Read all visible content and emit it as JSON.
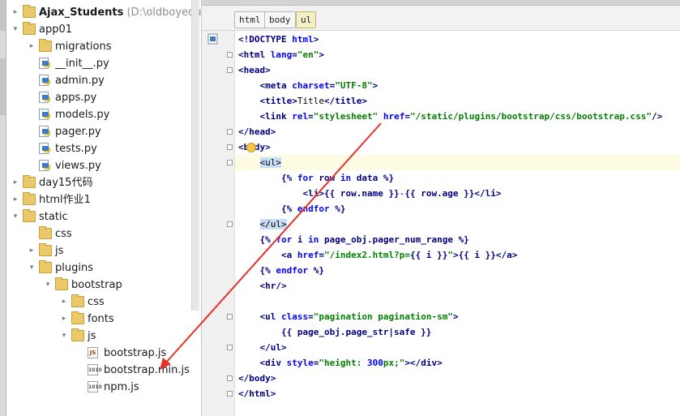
{
  "project": {
    "name": "Ajax_Students",
    "path": "(D:\\oldboyedu\\djang"
  },
  "tree": [
    {
      "label": "Ajax_Students",
      "depth": 0,
      "type": "folder",
      "expanded": false
    },
    {
      "label": "app01",
      "depth": 0,
      "type": "folder",
      "expanded": true
    },
    {
      "label": "migrations",
      "depth": 1,
      "type": "folder",
      "expanded": false
    },
    {
      "label": "__init__.py",
      "depth": 1,
      "type": "py"
    },
    {
      "label": "admin.py",
      "depth": 1,
      "type": "py"
    },
    {
      "label": "apps.py",
      "depth": 1,
      "type": "py"
    },
    {
      "label": "models.py",
      "depth": 1,
      "type": "py"
    },
    {
      "label": "pager.py",
      "depth": 1,
      "type": "py"
    },
    {
      "label": "tests.py",
      "depth": 1,
      "type": "py"
    },
    {
      "label": "views.py",
      "depth": 1,
      "type": "py"
    },
    {
      "label": "day15代码",
      "depth": 0,
      "type": "folder",
      "expanded": false
    },
    {
      "label": "html作业1",
      "depth": 0,
      "type": "folder",
      "expanded": false
    },
    {
      "label": "static",
      "depth": 0,
      "type": "folder",
      "expanded": true
    },
    {
      "label": "css",
      "depth": 1,
      "type": "folder",
      "leaf": true
    },
    {
      "label": "js",
      "depth": 1,
      "type": "folder",
      "expanded": false
    },
    {
      "label": "plugins",
      "depth": 1,
      "type": "folder",
      "expanded": true
    },
    {
      "label": "bootstrap",
      "depth": 2,
      "type": "folder",
      "expanded": true
    },
    {
      "label": "css",
      "depth": 3,
      "type": "folder",
      "expanded": false
    },
    {
      "label": "fonts",
      "depth": 3,
      "type": "folder",
      "expanded": false
    },
    {
      "label": "js",
      "depth": 3,
      "type": "folder",
      "expanded": true
    },
    {
      "label": "bootstrap.js",
      "depth": 4,
      "type": "js"
    },
    {
      "label": "bootstrap.min.js",
      "depth": 4,
      "type": "jsbin"
    },
    {
      "label": "npm.js",
      "depth": 4,
      "type": "jsbin"
    }
  ],
  "breadcrumbs": [
    "html",
    "body",
    "ul"
  ],
  "code_lines": [
    [
      [
        "tag",
        "<!DOCTYPE "
      ],
      [
        "attr",
        "html"
      ],
      [
        "tag",
        ">"
      ]
    ],
    [
      [
        "tag",
        "<html "
      ],
      [
        "attr",
        "lang"
      ],
      [
        "tag",
        "="
      ],
      [
        "str",
        "\"en\""
      ],
      [
        "tag",
        ">"
      ]
    ],
    [
      [
        "tag",
        "<head>"
      ]
    ],
    [
      [
        "",
        "    "
      ],
      [
        "tag",
        "<meta "
      ],
      [
        "attr",
        "charset"
      ],
      [
        "tag",
        "="
      ],
      [
        "str",
        "\"UTF-8\""
      ],
      [
        "tag",
        ">"
      ]
    ],
    [
      [
        "",
        "    "
      ],
      [
        "tag",
        "<title>"
      ],
      [
        "",
        "Title"
      ],
      [
        "tag",
        "</title>"
      ]
    ],
    [
      [
        "",
        "    "
      ],
      [
        "tag",
        "<link "
      ],
      [
        "attr",
        "rel"
      ],
      [
        "tag",
        "="
      ],
      [
        "str",
        "\"stylesheet\""
      ],
      [
        "tag",
        " "
      ],
      [
        "attr",
        "href"
      ],
      [
        "tag",
        "="
      ],
      [
        "str",
        "\"/static/plugins/bootstrap/css/bootstrap.css\""
      ],
      [
        "tag",
        "/>"
      ]
    ],
    [
      [
        "tag",
        "</head>"
      ]
    ],
    [
      [
        "tag",
        "<body>"
      ]
    ],
    [
      [
        "",
        "    "
      ],
      [
        "tagbox",
        "<ul>"
      ]
    ],
    [
      [
        "",
        "        "
      ],
      [
        "tpl",
        "{% "
      ],
      [
        "attr",
        "for "
      ],
      [
        "tpl",
        "row "
      ],
      [
        "attr",
        "in "
      ],
      [
        "tpl",
        "data %}"
      ]
    ],
    [
      [
        "",
        "            "
      ],
      [
        "tag",
        "<li>"
      ],
      [
        "tpl",
        "{{ row.name }}"
      ],
      [
        "",
        "-"
      ],
      [
        "tpl",
        "{{ row.age }}"
      ],
      [
        "tag",
        "</li>"
      ]
    ],
    [
      [
        "",
        "        "
      ],
      [
        "tpl",
        "{% "
      ],
      [
        "attr",
        "endfor"
      ],
      [
        "tpl",
        " %}"
      ]
    ],
    [
      [
        "",
        "    "
      ],
      [
        "tagbox",
        "</ul>"
      ]
    ],
    [
      [
        "",
        "    "
      ],
      [
        "tpl",
        "{% "
      ],
      [
        "attr",
        "for "
      ],
      [
        "tpl",
        "i "
      ],
      [
        "attr",
        "in "
      ],
      [
        "tpl",
        "page_obj.pager_num_range %}"
      ]
    ],
    [
      [
        "",
        "        "
      ],
      [
        "tag",
        "<a "
      ],
      [
        "attr",
        "href"
      ],
      [
        "tag",
        "="
      ],
      [
        "str",
        "\"/index2.html?p="
      ],
      [
        "tpl",
        "{{ i }}"
      ],
      [
        "str",
        "\""
      ],
      [
        "tag",
        ">"
      ],
      [
        "tpl",
        "{{ i }}"
      ],
      [
        "tag",
        "</a>"
      ]
    ],
    [
      [
        "",
        "    "
      ],
      [
        "tpl",
        "{% "
      ],
      [
        "attr",
        "endfor"
      ],
      [
        "tpl",
        " %}"
      ]
    ],
    [
      [
        "",
        "    "
      ],
      [
        "tag",
        "<hr/>"
      ]
    ],
    [
      [
        "",
        ""
      ]
    ],
    [
      [
        "",
        "    "
      ],
      [
        "tag",
        "<ul "
      ],
      [
        "attr",
        "class"
      ],
      [
        "tag",
        "="
      ],
      [
        "str",
        "\"pagination pagination-sm\""
      ],
      [
        "tag",
        ">"
      ]
    ],
    [
      [
        "",
        "        "
      ],
      [
        "tpl",
        "{{ page_obj.page_str|safe }}"
      ]
    ],
    [
      [
        "",
        "    "
      ],
      [
        "tag",
        "</ul>"
      ]
    ],
    [
      [
        "",
        "    "
      ],
      [
        "tag",
        "<div "
      ],
      [
        "attr",
        "style"
      ],
      [
        "tag",
        "="
      ],
      [
        "str",
        "\"height: "
      ],
      [
        "attr",
        "300"
      ],
      [
        "str",
        "px;\""
      ],
      [
        "tag",
        ">"
      ],
      [
        "tag",
        "</div>"
      ]
    ],
    [
      [
        "tag",
        "</body>"
      ]
    ],
    [
      [
        "tag",
        "</html>"
      ]
    ]
  ],
  "colors": {
    "annotation_arrow": "#e8302a",
    "highlight_line": "#fdfbe2",
    "tag_box": "#c7dcf5"
  },
  "icons": [
    "folder-icon",
    "python-file-icon",
    "js-file-icon",
    "fold-marker-icon",
    "html-file-icon",
    "bulb-icon"
  ]
}
